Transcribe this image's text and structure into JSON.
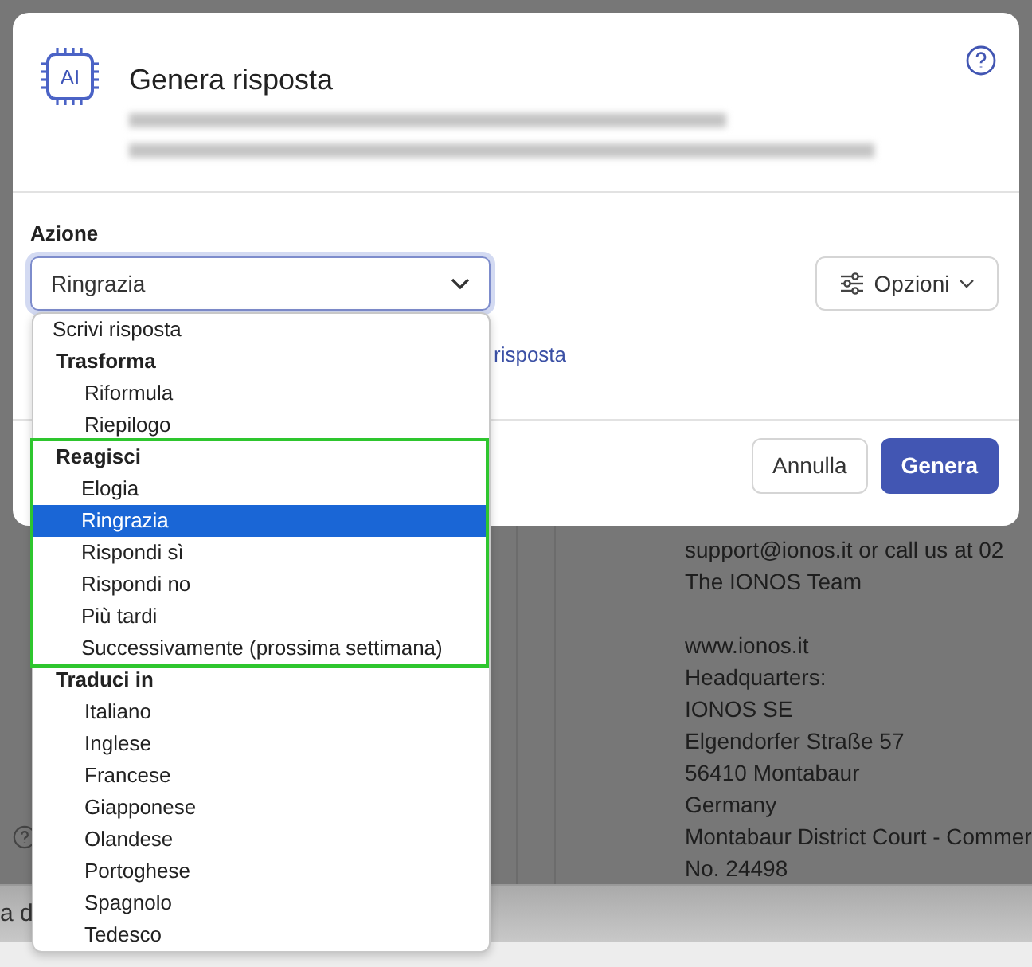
{
  "background": {
    "email_lines": [
      "support@ionos.it or call us at 02",
      "The IONOS Team"
    ],
    "signature_lines": [
      "www.ionos.it",
      "Headquarters:",
      "IONOS SE",
      "Elgendorfer Straße 57",
      "56410 Montabaur",
      "Germany",
      "Montabaur District Court - Commer",
      "No. 24498"
    ],
    "footer_text": "a d"
  },
  "dialog": {
    "icon_text": "AI",
    "title": "Genera risposta",
    "action_label": "Azione",
    "select_value": "Ringrazia",
    "options_button": "Opzioni",
    "link_text": "risposta",
    "buttons": [
      {
        "label": "Annulla",
        "kind": "secondary"
      },
      {
        "label": "Genera",
        "kind": "primary"
      }
    ]
  },
  "dropdown": {
    "items": [
      {
        "kind": "option",
        "label": "Scrivi risposta",
        "selected": false
      },
      {
        "kind": "group",
        "label": "Trasforma",
        "highlighted": false,
        "children": [
          {
            "label": "Riformula",
            "selected": false
          },
          {
            "label": "Riepilogo",
            "selected": false
          }
        ]
      },
      {
        "kind": "group",
        "label": "Reagisci",
        "highlighted": true,
        "children": [
          {
            "label": "Elogia",
            "selected": false
          },
          {
            "label": "Ringrazia",
            "selected": true
          },
          {
            "label": "Rispondi sì",
            "selected": false
          },
          {
            "label": "Rispondi no",
            "selected": false
          },
          {
            "label": "Più tardi",
            "selected": false
          },
          {
            "label": "Successivamente (prossima settimana)",
            "selected": false
          }
        ]
      },
      {
        "kind": "group",
        "label": "Traduci in",
        "highlighted": false,
        "children": [
          {
            "label": "Italiano",
            "selected": false
          },
          {
            "label": "Inglese",
            "selected": false
          },
          {
            "label": "Francese",
            "selected": false
          },
          {
            "label": "Giapponese",
            "selected": false
          },
          {
            "label": "Olandese",
            "selected": false
          },
          {
            "label": "Portoghese",
            "selected": false
          },
          {
            "label": "Spagnolo",
            "selected": false
          },
          {
            "label": "Tedesco",
            "selected": false
          }
        ]
      }
    ]
  }
}
